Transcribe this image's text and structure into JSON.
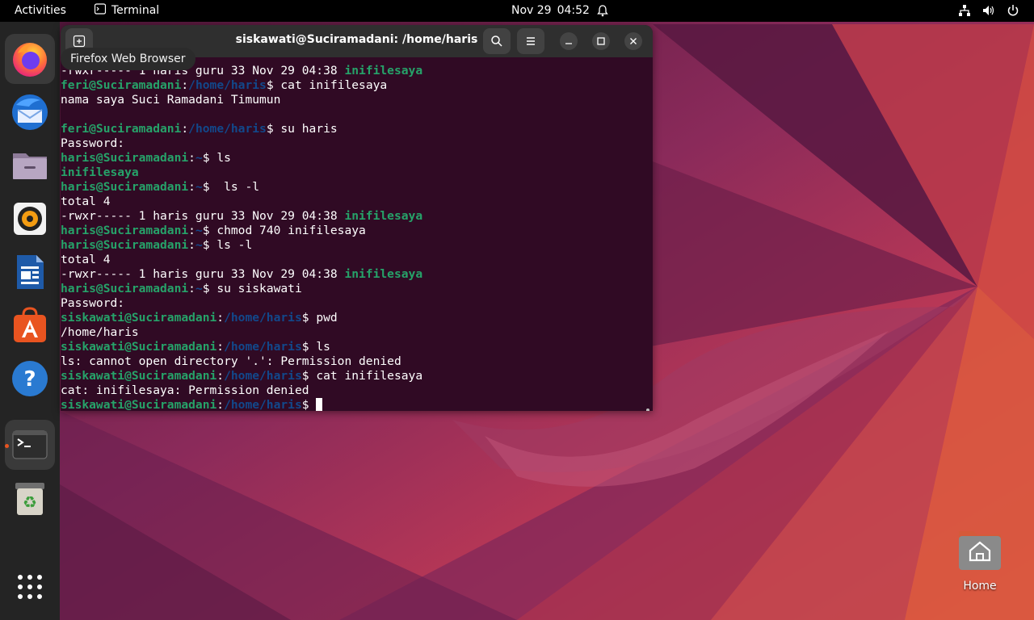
{
  "topbar": {
    "activities": "Activities",
    "app_name": "Terminal",
    "date": "Nov 29",
    "time": "04:52",
    "icons": [
      "terminal-app-icon",
      "bell-icon",
      "network-icon",
      "volume-icon",
      "power-icon"
    ]
  },
  "dock": {
    "items": [
      "firefox",
      "thunderbird",
      "files",
      "rhythmbox",
      "writer",
      "app-center",
      "help",
      "terminal",
      "trash"
    ],
    "show_apps_icon": "app-grid-icon"
  },
  "tooltip": {
    "text": "Firefox Web Browser"
  },
  "terminal": {
    "title": "siskawati@Suciramadani: /home/haris",
    "lines": [
      {
        "parts": [
          [
            "plain",
            "-rwxr----- 1 haris guru 33 Nov 29 04:38 "
          ],
          [
            "d",
            "inifilesaya"
          ]
        ]
      },
      {
        "parts": [
          [
            "u",
            "feri@Suciramadani"
          ],
          [
            "plain",
            ":"
          ],
          [
            "p",
            "/home/haris"
          ],
          [
            "plain",
            "$ cat inifilesaya"
          ]
        ]
      },
      {
        "parts": [
          [
            "plain",
            "nama saya Suci Ramadani Timumun"
          ]
        ]
      },
      {
        "parts": [
          [
            "plain",
            ""
          ]
        ]
      },
      {
        "parts": [
          [
            "u",
            "feri@Suciramadani"
          ],
          [
            "plain",
            ":"
          ],
          [
            "p",
            "/home/haris"
          ],
          [
            "plain",
            "$ su haris"
          ]
        ]
      },
      {
        "parts": [
          [
            "plain",
            "Password:"
          ]
        ]
      },
      {
        "parts": [
          [
            "u",
            "haris@Suciramadani"
          ],
          [
            "plain",
            ":"
          ],
          [
            "p",
            "~"
          ],
          [
            "plain",
            "$ ls"
          ]
        ]
      },
      {
        "parts": [
          [
            "d",
            "inifilesaya"
          ]
        ]
      },
      {
        "parts": [
          [
            "u",
            "haris@Suciramadani"
          ],
          [
            "plain",
            ":"
          ],
          [
            "p",
            "~"
          ],
          [
            "plain",
            "$  ls -l"
          ]
        ]
      },
      {
        "parts": [
          [
            "plain",
            "total 4"
          ]
        ]
      },
      {
        "parts": [
          [
            "plain",
            "-rwxr----- 1 haris guru 33 Nov 29 04:38 "
          ],
          [
            "d",
            "inifilesaya"
          ]
        ]
      },
      {
        "parts": [
          [
            "u",
            "haris@Suciramadani"
          ],
          [
            "plain",
            ":"
          ],
          [
            "p",
            "~"
          ],
          [
            "plain",
            "$ chmod 740 inifilesaya"
          ]
        ]
      },
      {
        "parts": [
          [
            "u",
            "haris@Suciramadani"
          ],
          [
            "plain",
            ":"
          ],
          [
            "p",
            "~"
          ],
          [
            "plain",
            "$ ls -l"
          ]
        ]
      },
      {
        "parts": [
          [
            "plain",
            "total 4"
          ]
        ]
      },
      {
        "parts": [
          [
            "plain",
            "-rwxr----- 1 haris guru 33 Nov 29 04:38 "
          ],
          [
            "d",
            "inifilesaya"
          ]
        ]
      },
      {
        "parts": [
          [
            "u",
            "haris@Suciramadani"
          ],
          [
            "plain",
            ":"
          ],
          [
            "p",
            "~"
          ],
          [
            "plain",
            "$ su siskawati"
          ]
        ]
      },
      {
        "parts": [
          [
            "plain",
            "Password:"
          ]
        ]
      },
      {
        "parts": [
          [
            "u",
            "siskawati@Suciramadani"
          ],
          [
            "plain",
            ":"
          ],
          [
            "p",
            "/home/haris"
          ],
          [
            "plain",
            "$ pwd"
          ]
        ]
      },
      {
        "parts": [
          [
            "plain",
            "/home/haris"
          ]
        ]
      },
      {
        "parts": [
          [
            "u",
            "siskawati@Suciramadani"
          ],
          [
            "plain",
            ":"
          ],
          [
            "p",
            "/home/haris"
          ],
          [
            "plain",
            "$ ls"
          ]
        ]
      },
      {
        "parts": [
          [
            "plain",
            "ls: cannot open directory '.': Permission denied"
          ]
        ]
      },
      {
        "parts": [
          [
            "u",
            "siskawati@Suciramadani"
          ],
          [
            "plain",
            ":"
          ],
          [
            "p",
            "/home/haris"
          ],
          [
            "plain",
            "$ cat inifilesaya"
          ]
        ]
      },
      {
        "parts": [
          [
            "plain",
            "cat: inifilesaya: Permission denied"
          ]
        ]
      },
      {
        "parts": [
          [
            "u",
            "siskawati@Suciramadani"
          ],
          [
            "plain",
            ":"
          ],
          [
            "p",
            "/home/haris"
          ],
          [
            "plain",
            "$ "
          ]
        ],
        "cursor": true
      }
    ]
  },
  "desktop": {
    "home_label": "Home"
  },
  "colors": {
    "accent": "#e95420",
    "terminal_bg": "#300a24",
    "prompt_user": "#26a269",
    "prompt_path": "#12488b"
  }
}
